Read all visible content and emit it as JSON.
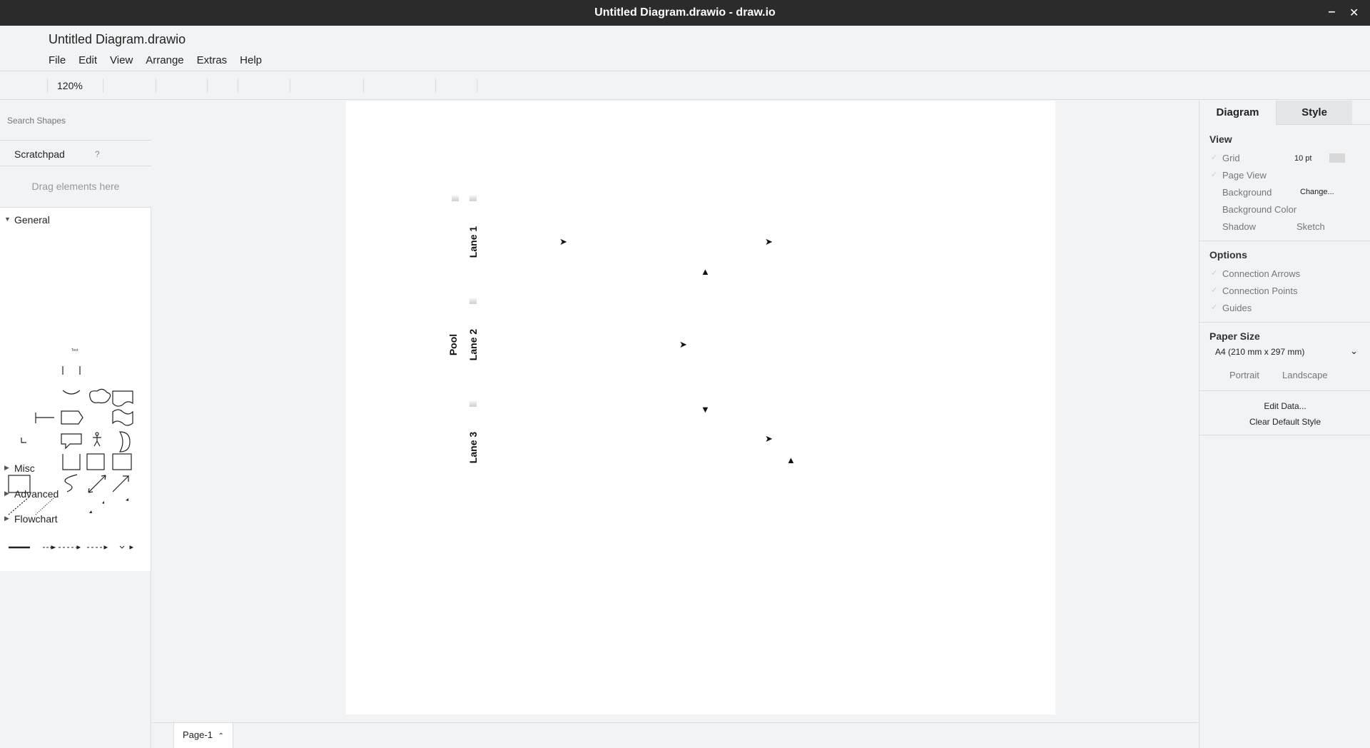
{
  "window": {
    "title": "Untitled Diagram.drawio - draw.io",
    "minimize_label": "‒",
    "close_label": "✕"
  },
  "header": {
    "doc_title": "Untitled Diagram.drawio",
    "menus": [
      "File",
      "Edit",
      "View",
      "Arrange",
      "Extras",
      "Help"
    ]
  },
  "toolbar": {
    "zoom": "120%"
  },
  "sidebar": {
    "search_placeholder": "Search Shapes",
    "scratchpad": {
      "title": "Scratchpad",
      "help": "?",
      "drop_hint": "Drag elements here"
    },
    "sections": [
      {
        "label": "General",
        "expanded": true
      },
      {
        "label": "Misc",
        "expanded": false
      },
      {
        "label": "Advanced",
        "expanded": false
      },
      {
        "label": "Flowchart",
        "expanded": false
      }
    ],
    "general_text_shape": "Text"
  },
  "diagram": {
    "pool_label": "Pool",
    "lanes": [
      "Lane 1",
      "Lane 2",
      "Lane 3"
    ]
  },
  "page_tabs": {
    "current": "Page-1",
    "menu_icon": "⌃"
  },
  "format_panel": {
    "tabs": [
      "Diagram",
      "Style"
    ],
    "view": {
      "title": "View",
      "grid_label": "Grid",
      "grid_size": "10 pt",
      "page_view": "Page View",
      "background": "Background",
      "change_button": "Change...",
      "background_color": "Background Color",
      "shadow": "Shadow",
      "sketch": "Sketch"
    },
    "options": {
      "title": "Options",
      "connection_arrows": "Connection Arrows",
      "connection_points": "Connection Points",
      "guides": "Guides"
    },
    "paper_size": {
      "title": "Paper Size",
      "selected": "A4 (210 mm x 297 mm)",
      "portrait": "Portrait",
      "landscape": "Landscape"
    },
    "edit_data": "Edit Data...",
    "clear_default_style": "Clear Default Style"
  },
  "colors": {
    "titlebar": "#2b2b2b",
    "chrome": "#f1f3f4",
    "border": "#dadce0",
    "canvas": "#ffffff"
  }
}
